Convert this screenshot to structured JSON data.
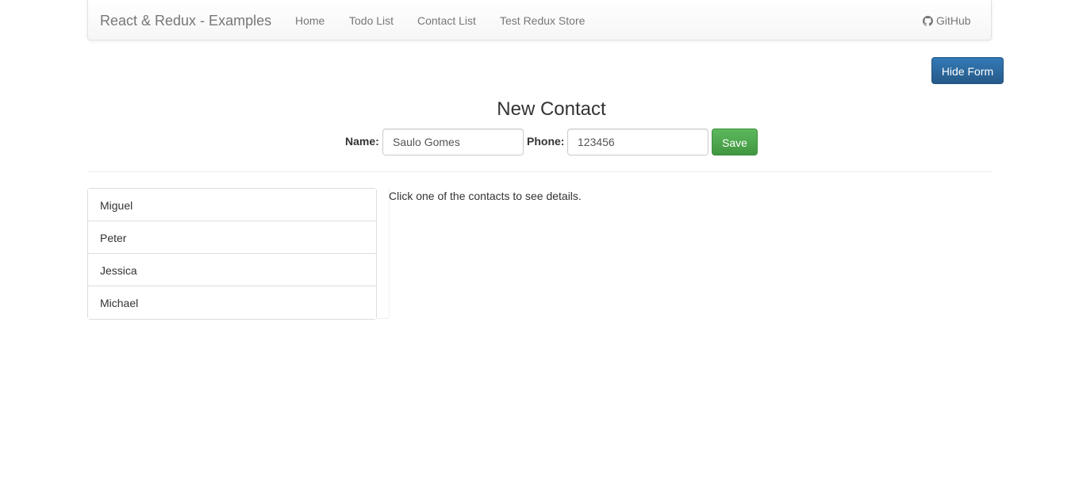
{
  "navbar": {
    "brand": "React & Redux - Examples",
    "links": [
      "Home",
      "Todo List",
      "Contact List",
      "Test Redux Store"
    ],
    "github_label": "GitHub",
    "github_icon": "github-icon"
  },
  "toolbar": {
    "hide_form_label": "Hide Form"
  },
  "form": {
    "title": "New Contact",
    "name_label": "Name:",
    "name_value": "Saulo Gomes",
    "phone_label": "Phone:",
    "phone_value": "123456",
    "save_label": "Save"
  },
  "contacts": {
    "items": [
      "Miguel",
      "Peter",
      "Jessica",
      "Michael"
    ],
    "hint": "Click one of the contacts to see details."
  },
  "colors": {
    "primary": "#337ab7",
    "success": "#5cb85c",
    "nav_text": "#777777"
  }
}
